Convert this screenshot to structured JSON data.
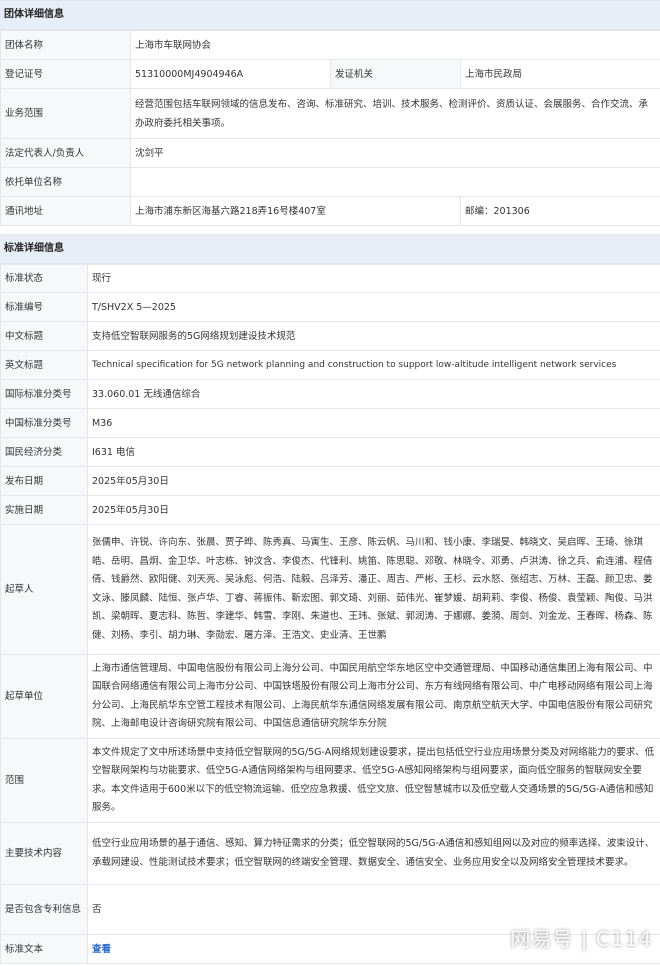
{
  "group": {
    "header": "团体详细信息",
    "rows": {
      "name": {
        "label": "团体名称",
        "value": "上海市车联网协会"
      },
      "reg_no": {
        "label": "登记证号",
        "value": "51310000MJ4904946A"
      },
      "issuer": {
        "label": "发证机关",
        "value": "上海市民政局"
      },
      "scope": {
        "label": "业务范围",
        "value": "经营范围包括车联网领域的信息发布、咨询、标准研究、培训、技术服务、检测评价、资质认证、会展服务、合作交流、承办政府委托相关事项。"
      },
      "legal_rep": {
        "label": "法定代表人/负责人",
        "value": "沈剑平"
      },
      "supervisor": {
        "label": "依托单位名称",
        "value": ""
      },
      "address": {
        "label": "通讯地址",
        "value": "上海市浦东新区海基六路218弄16号楼407室"
      },
      "postcode": {
        "value": "邮编：201306"
      }
    }
  },
  "standard": {
    "header": "标准详细信息",
    "rows": {
      "status": {
        "label": "标准状态",
        "value": "现行"
      },
      "number": {
        "label": "标准编号",
        "value": "T/SHV2X 5—2025"
      },
      "cn_title": {
        "label": "中文标题",
        "value": "支持低空智联网服务的5G网络规划建设技术规范"
      },
      "en_title": {
        "label": "英文标题",
        "value": "Technical specification for 5G network planning and construction to support low-altitude intelligent network services"
      },
      "ics": {
        "label": "国际标准分类号",
        "value": "33.060.01 无线通信综合"
      },
      "ccs": {
        "label": "中国标准分类号",
        "value": "M36"
      },
      "industry": {
        "label": "国民经济分类",
        "value": "I631 电信"
      },
      "publish_date": {
        "label": "发布日期",
        "value": "2025年05月30日"
      },
      "impl_date": {
        "label": "实施日期",
        "value": "2025年05月30日"
      },
      "drafters": {
        "label": "起草人",
        "value": "张儒申、许锐、许向东、张晨、贾子晔、陈秀真、马寅生、王彦、陈云帆、马川和、钱小康、李瑞旻、韩晓文、吴启晖、王琦、徐琪皓、岳明、昌炯、金卫华、叶志栋、钟汶含、李俊杰、代锋利、姚笛、陈思聪、邓敬、林晓令、邓勇、卢洪涛、徐之兵、俞连浦、程倩倩、钱爵然、欧阳健、刘天亮、吴泳彪、何浩、陆毅、吕泽芳、潘正、周吉、严彬、王杉、云水怒、张绍志、万林、王磊、颜卫忠、姜文泳、滕凤麟、陆恒、张卢华、丁睿、蒋振伟、靳宏图、郭文琦、刘丽、茹伟光、崔梦媛、胡莉莉、李俊、杨俊、袁莹颖、陶俊、马洪凯、梁朝晖、夏志科、陈哲、李建华、韩雪、李刚、朱道也、王玮、张斌、郭润涛、于娜娜、姜漪、周剑、刘金龙、王春晖、杨森、陈健、刘杨、李引、胡力琳、李勋宏、屠方泽、王浩文、史业清、王世鹏"
      },
      "draft_units": {
        "label": "起草单位",
        "value": "上海市通信管理局、中国电信股份有限公司上海分公司、中国民用航空华东地区空中交通管理局、中国移动通信集团上海有限公司、中国联合网络通信有限公司上海市分公司、中国铁塔股份有限公司上海市分公司、东方有线网络有限公司、中广电移动网络有限公司上海分公司、上海民航华东空管工程技术有限公司、上海民航华东通信网络发展有限公司、南京航空航天大学、中国电信股份有限公司研究院、上海邮电设计咨询研究院有限公司、中国信息通信研究院华东分院"
      },
      "scope": {
        "label": "范围",
        "value": "本文件规定了文中所述场景中支持低空智联网的5G/5G-A网络规划建设要求，提出包括低空行业应用场景分类及对网络能力的要求、低空智联网架构与功能要求、低空5G-A通信网络架构与组网要求、低空5G-A感知网络架构与组网要求，面向低空服务的智联网安全要求。本文件适用于600米以下的低空物流运输、低空应急救援、低空文旅、低空智慧城市以及低空载人交通场景的5G/5G-A通信和感知服务。"
      },
      "tech_content": {
        "label": "主要技术内容",
        "value": "低空行业应用场景的基于通信、感知、算力特征需求的分类；低空智联网的5G/5G-A通信和感知组网以及对应的频率选择、波束设计、承载网建设、性能测试技术要求；低空智联网的终端安全管理、数据安全、通信安全、业务应用安全以及网络安全管理技术要求。"
      },
      "patent": {
        "label": "是否包含专利信息",
        "value": "否"
      },
      "text": {
        "label": "标准文本",
        "value": "查看"
      }
    }
  },
  "watermark": "网易号 | C114"
}
